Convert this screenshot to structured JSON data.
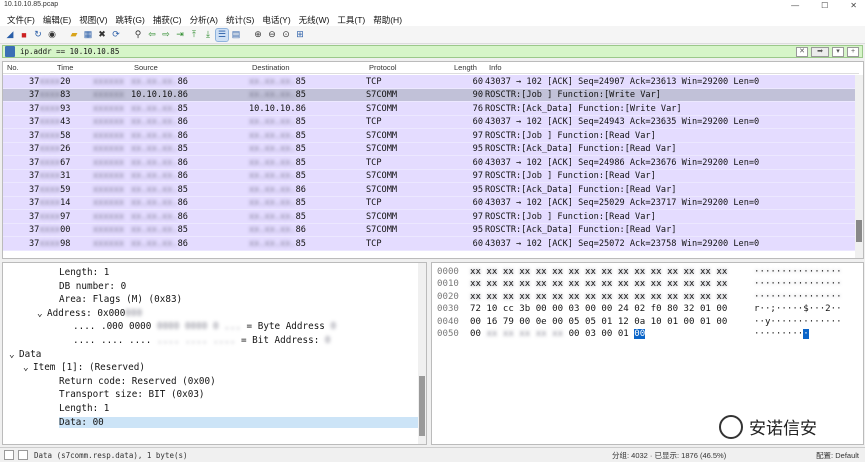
{
  "window": {
    "title": "10.10.10.85.pcap",
    "minimize": "—",
    "maximize": "☐",
    "close": "✕"
  },
  "menu": [
    "文件(F)",
    "编辑(E)",
    "视图(V)",
    "跳转(G)",
    "捕获(C)",
    "分析(A)",
    "统计(S)",
    "电话(Y)",
    "无线(W)",
    "工具(T)",
    "帮助(H)"
  ],
  "toolbar_icons": [
    "shark-fin-icon",
    "stop-icon",
    "restart-icon",
    "options-icon",
    "open-icon",
    "save-icon",
    "close-file-icon",
    "reload-icon",
    "find-icon",
    "back-icon",
    "forward-icon",
    "goto-icon",
    "first-icon",
    "last-icon",
    "autoscroll-icon",
    "colorize-icon",
    "zoom-in-icon",
    "zoom-out-icon",
    "zoom-normal-icon",
    "resize-columns-icon"
  ],
  "filter": {
    "value": "ip.addr == 10.10.10.85"
  },
  "columns": {
    "no": "No.",
    "time": "Time",
    "source": "Source",
    "destination": "Destination",
    "protocol": "Protocol",
    "length": "Length",
    "info": "Info"
  },
  "packets": [
    {
      "no": "37",
      "no_tail": "20",
      "src": "10.10.10.86",
      "src_vis": "86",
      "dst_vis": "85",
      "proto": "TCP",
      "len": "60",
      "info": "43037 → 102 [ACK] Seq=24907 Ack=23613 Win=29200 Len=0",
      "selected": false,
      "src_clear": false,
      "dst_clear": false
    },
    {
      "no": "37",
      "no_tail": "83",
      "src": "10.10.10.86",
      "src_vis": "10.10.10.86",
      "dst_vis": "85",
      "proto": "S7COMM",
      "len": "90",
      "info": "ROSCTR:[Job      ] Function:[Write Var]",
      "selected": true,
      "src_clear": true,
      "dst_clear": false
    },
    {
      "no": "37",
      "no_tail": "93",
      "src_vis": "85",
      "dst_vis": "10.10.10.86",
      "proto": "S7COMM",
      "len": "76",
      "info": "ROSCTR:[Ack_Data] Function:[Write Var]",
      "selected": false,
      "src_clear": false,
      "dst_clear": true
    },
    {
      "no": "37",
      "no_tail": "43",
      "src_vis": "86",
      "dst_vis": "85",
      "proto": "TCP",
      "len": "60",
      "info": "43037 → 102 [ACK] Seq=24943 Ack=23635 Win=29200 Len=0",
      "selected": false
    },
    {
      "no": "37",
      "no_tail": "58",
      "src_vis": "86",
      "dst_vis": "85",
      "proto": "S7COMM",
      "len": "97",
      "info": "ROSCTR:[Job      ] Function:[Read Var]",
      "selected": false
    },
    {
      "no": "37",
      "no_tail": "26",
      "src_vis": "85",
      "dst_vis": "85",
      "proto": "S7COMM",
      "len": "95",
      "info": "ROSCTR:[Ack_Data] Function:[Read Var]",
      "selected": false
    },
    {
      "no": "37",
      "no_tail": "67",
      "src_vis": "86",
      "dst_vis": "85",
      "proto": "TCP",
      "len": "60",
      "info": "43037 → 102 [ACK] Seq=24986 Ack=23676 Win=29200 Len=0",
      "selected": false
    },
    {
      "no": "37",
      "no_tail": "31",
      "src_vis": "86",
      "dst_vis": "85",
      "proto": "S7COMM",
      "len": "97",
      "info": "ROSCTR:[Job      ] Function:[Read Var]",
      "selected": false
    },
    {
      "no": "37",
      "no_tail": "59",
      "src_vis": "85",
      "dst_vis": "86",
      "proto": "S7COMM",
      "len": "95",
      "info": "ROSCTR:[Ack_Data] Function:[Read Var]",
      "selected": false
    },
    {
      "no": "37",
      "no_tail": "14",
      "src_vis": "86",
      "dst_vis": "85",
      "proto": "TCP",
      "len": "60",
      "info": "43037 → 102 [ACK] Seq=25029 Ack=23717 Win=29200 Len=0",
      "selected": false
    },
    {
      "no": "37",
      "no_tail": "97",
      "src_vis": "86",
      "dst_vis": "85",
      "proto": "S7COMM",
      "len": "97",
      "info": "ROSCTR:[Job      ] Function:[Read Var]",
      "selected": false
    },
    {
      "no": "37",
      "no_tail": "00",
      "src_vis": "85",
      "dst_vis": "86",
      "proto": "S7COMM",
      "len": "95",
      "info": "ROSCTR:[Ack_Data] Function:[Read Var]",
      "selected": false
    },
    {
      "no": "37",
      "no_tail": "98",
      "src_vis": "86",
      "dst_vis": "85",
      "proto": "TCP",
      "len": "60",
      "info": "43037 → 102 [ACK] Seq=25072 Ack=23758 Win=29200 Len=0",
      "selected": false
    }
  ],
  "detail_lines": [
    {
      "indent": 0,
      "text": "Length: 1"
    },
    {
      "indent": 0,
      "text": "DB number: 0"
    },
    {
      "indent": 0,
      "text": "Area: Flags (M) (0x83)"
    },
    {
      "indent": -1,
      "text": "Address: 0x000"
    },
    {
      "indent": 1,
      "text": ".... .000 0000"
    },
    {
      "indent": 1,
      "text": ".... .... ...."
    },
    {
      "indent": -3,
      "text": "Data"
    },
    {
      "indent": -2,
      "text": "Item [1]: (Reserved)"
    },
    {
      "indent": 0,
      "text": "Return code: Reserved (0x00)"
    },
    {
      "indent": 0,
      "text": "Transport size: BIT (0x03)"
    },
    {
      "indent": 0,
      "text": "Length: 1"
    },
    {
      "indent": 0,
      "text": "Data: 00"
    }
  ],
  "detail_tails": {
    "byte_address": "= Byte Address",
    "bit_address": "= Bit Address:"
  },
  "hex_offsets": [
    "0000",
    "0010",
    "0020",
    "0030",
    "0040",
    "0050"
  ],
  "hex_visible": {
    "row30": "72 10 cc 3b 00 00 03 00   00 24 02 f0 80 32 01 00",
    "row40": "00 16 79 00 0e 00 05 05   01 12 0a 10 01 00 01 00",
    "row50_end": "00 03 00   01",
    "row50_hl": "00",
    "ascii30": "r··;·····$···2··",
    "ascii40": "··y·············",
    "ascii50": "·········"
  },
  "status": {
    "text": "Data (s7comm.resp.data), 1 byte(s)",
    "packets": "分组: 4032 · 已显示: 1876 (46.5%)",
    "profile": "配置: Default"
  },
  "watermark": "安诺信安"
}
